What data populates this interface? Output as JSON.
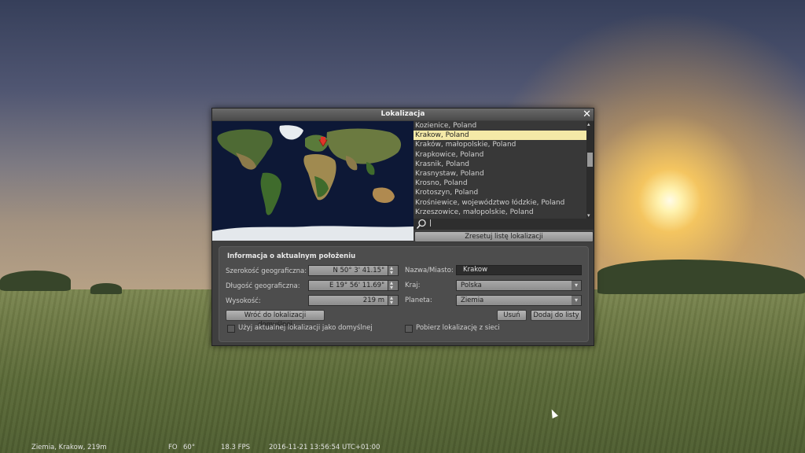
{
  "dialog": {
    "title": "Lokalizacja",
    "close_icon": "close-icon"
  },
  "location_list": {
    "items": [
      {
        "label": "Kozienice, Poland",
        "selected": false
      },
      {
        "label": "Krakow, Poland",
        "selected": true
      },
      {
        "label": "Kraków, małopolskie, Poland",
        "selected": false
      },
      {
        "label": "Krapkowice, Poland",
        "selected": false
      },
      {
        "label": "Krasnik, Poland",
        "selected": false
      },
      {
        "label": "Krasnystaw, Poland",
        "selected": false
      },
      {
        "label": "Krosno, Poland",
        "selected": false
      },
      {
        "label": "Krotoszyn, Poland",
        "selected": false
      },
      {
        "label": "Krośniewice, województwo łódzkie, Poland",
        "selected": false
      },
      {
        "label": "Krzeszowice, małopolskie, Poland",
        "selected": false
      }
    ],
    "search_value": "|",
    "reset_button": "Zresetuj listę lokalizacji"
  },
  "info": {
    "heading": "Informacja o aktualnym położeniu",
    "latitude_label": "Szerokość geograficzna:",
    "latitude_value": "N 50° 3' 41.15\"",
    "longitude_label": "Długość geograficzna:",
    "longitude_value": "E 19° 56' 11.69\"",
    "altitude_label": "Wysokość:",
    "altitude_value": "219 m",
    "name_label": "Nazwa/Miasto:",
    "name_value": "Krakow",
    "country_label": "Kraj:",
    "country_value": "Polska",
    "planet_label": "Planeta:",
    "planet_value": "Ziemia",
    "return_default_button": "Wróć do lokalizacji domyślnej",
    "delete_button": "Usuń",
    "add_button": "Dodaj do listy",
    "use_as_default_label": "Użyj aktualnej lokalizacji jako domyślnej",
    "get_from_network_label": "Pobierz lokalizację z sieci"
  },
  "status": {
    "location": "Ziemia, Krakow, 219m",
    "fov_label": "FO",
    "fov_value": "60°",
    "fps": "18.3 FPS",
    "datetime": "2016-11-21   13:56:54 UTC+01:00"
  },
  "colors": {
    "selection": "#f4e9a7",
    "marker": "#e0342a"
  }
}
